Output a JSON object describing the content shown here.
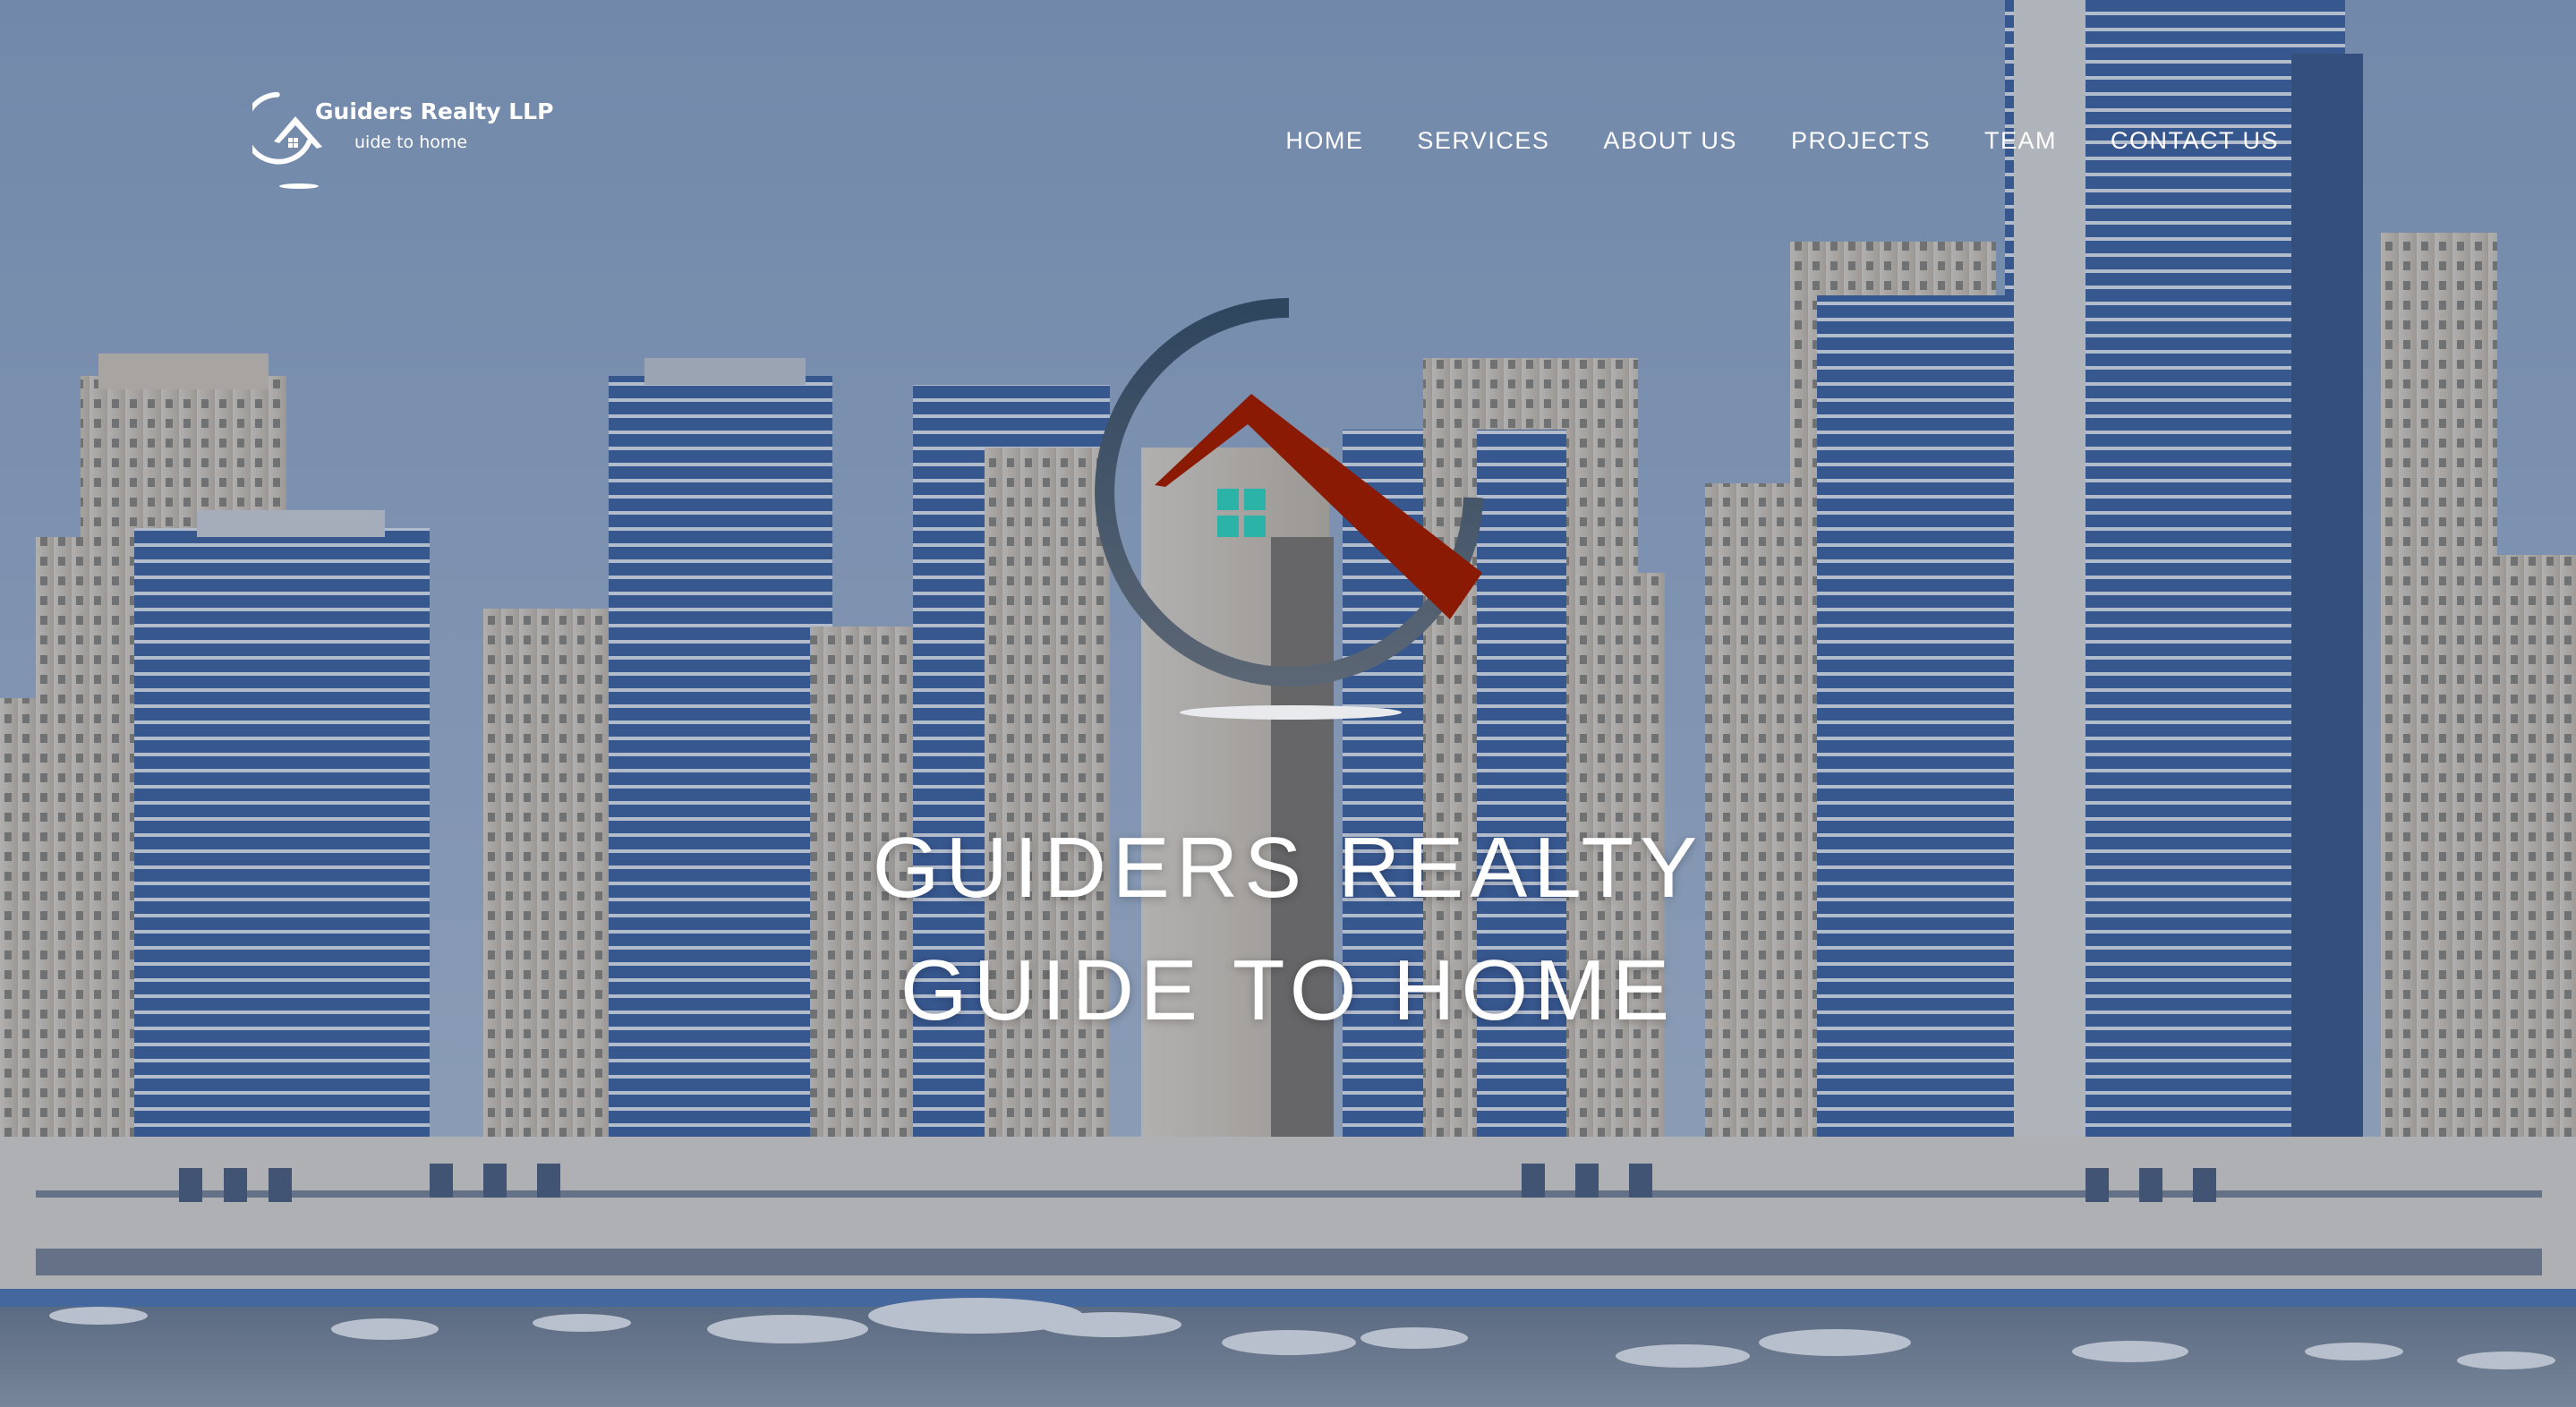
{
  "brand": {
    "name": "Guiders Realty LLP",
    "tagline": "uide to home"
  },
  "nav": {
    "items": [
      {
        "label": "HOME"
      },
      {
        "label": "SERVICES"
      },
      {
        "label": "ABOUT US"
      },
      {
        "label": "PROJECTS"
      },
      {
        "label": "TEAM"
      },
      {
        "label": "CONTACT US"
      }
    ]
  },
  "hero": {
    "line1": "GUIDERS REALTY",
    "line2": "GUIDE TO HOME",
    "background": "dubai-marina-skyline",
    "logo": "house-in-circle-logo"
  },
  "colors": {
    "overlay": "#283e64",
    "logo_ring": "#34495e",
    "logo_roof": "#8b1a05",
    "logo_window": "#2bb3a8"
  }
}
